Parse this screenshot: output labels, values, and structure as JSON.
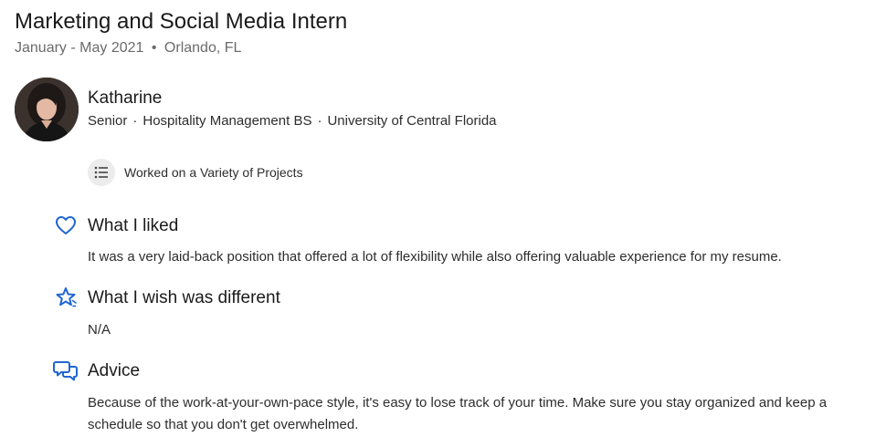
{
  "review": {
    "title": "Marketing and Social Media Intern",
    "dates": "January - May 2021",
    "separator": "•",
    "location": "Orlando, FL"
  },
  "author": {
    "name": "Katharine",
    "year": "Senior",
    "major": "Hospitality Management BS",
    "school": "University of Central Florida",
    "dot": "·"
  },
  "tag": {
    "icon": "list-icon",
    "label": "Worked on a Variety of Projects"
  },
  "sections": {
    "liked": {
      "icon": "heart-icon",
      "title": "What I liked",
      "body": "It was a very laid-back position that offered a lot of flexibility while also offering valuable experience for my resume."
    },
    "wish": {
      "icon": "star-icon",
      "title": "What I wish was different",
      "body": "N/A"
    },
    "advice": {
      "icon": "chat-bubbles-icon",
      "title": "Advice",
      "body": "Because of the work-at-your-own-pace style, it's easy to lose track of your time. Make sure you stay organized and keep a schedule so that you don't get overwhelmed."
    }
  },
  "colors": {
    "accent": "#1f66d1",
    "text": "#1f1f1f",
    "muted": "#6b6b6b",
    "chip_bg": "#ececec"
  }
}
